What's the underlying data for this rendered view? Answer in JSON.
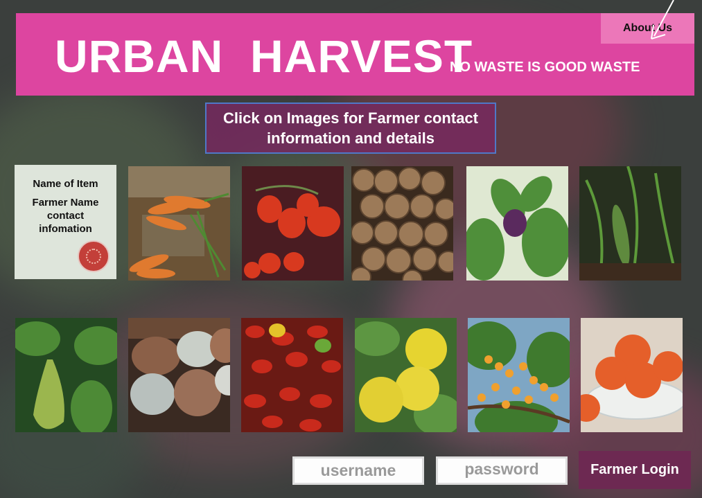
{
  "header": {
    "brand": "URBAN  HARVEST",
    "tagline": "NO WASTE IS GOOD WASTE",
    "about_label": "About Us"
  },
  "hint": "Click on Images for Farmer contact information and details",
  "info_card": {
    "item_name": "Name of Item",
    "farmer_info": "Farmer Name contact infomation",
    "icon": "tomato-slice-icon"
  },
  "products": {
    "row1": [
      "carrots",
      "cherry-tomatoes",
      "walnuts",
      "plum",
      "cucumber"
    ],
    "row2": [
      "pear",
      "eggs",
      "chili-peppers",
      "lemons",
      "apricots",
      "persimmons"
    ]
  },
  "login": {
    "username_placeholder": "username",
    "password_placeholder": "password",
    "button_label": "Farmer Login"
  },
  "colors": {
    "header": "#dd45a0",
    "about": "#ec77b9",
    "login_button": "#6d2952",
    "hint_border": "#4f78c9"
  }
}
